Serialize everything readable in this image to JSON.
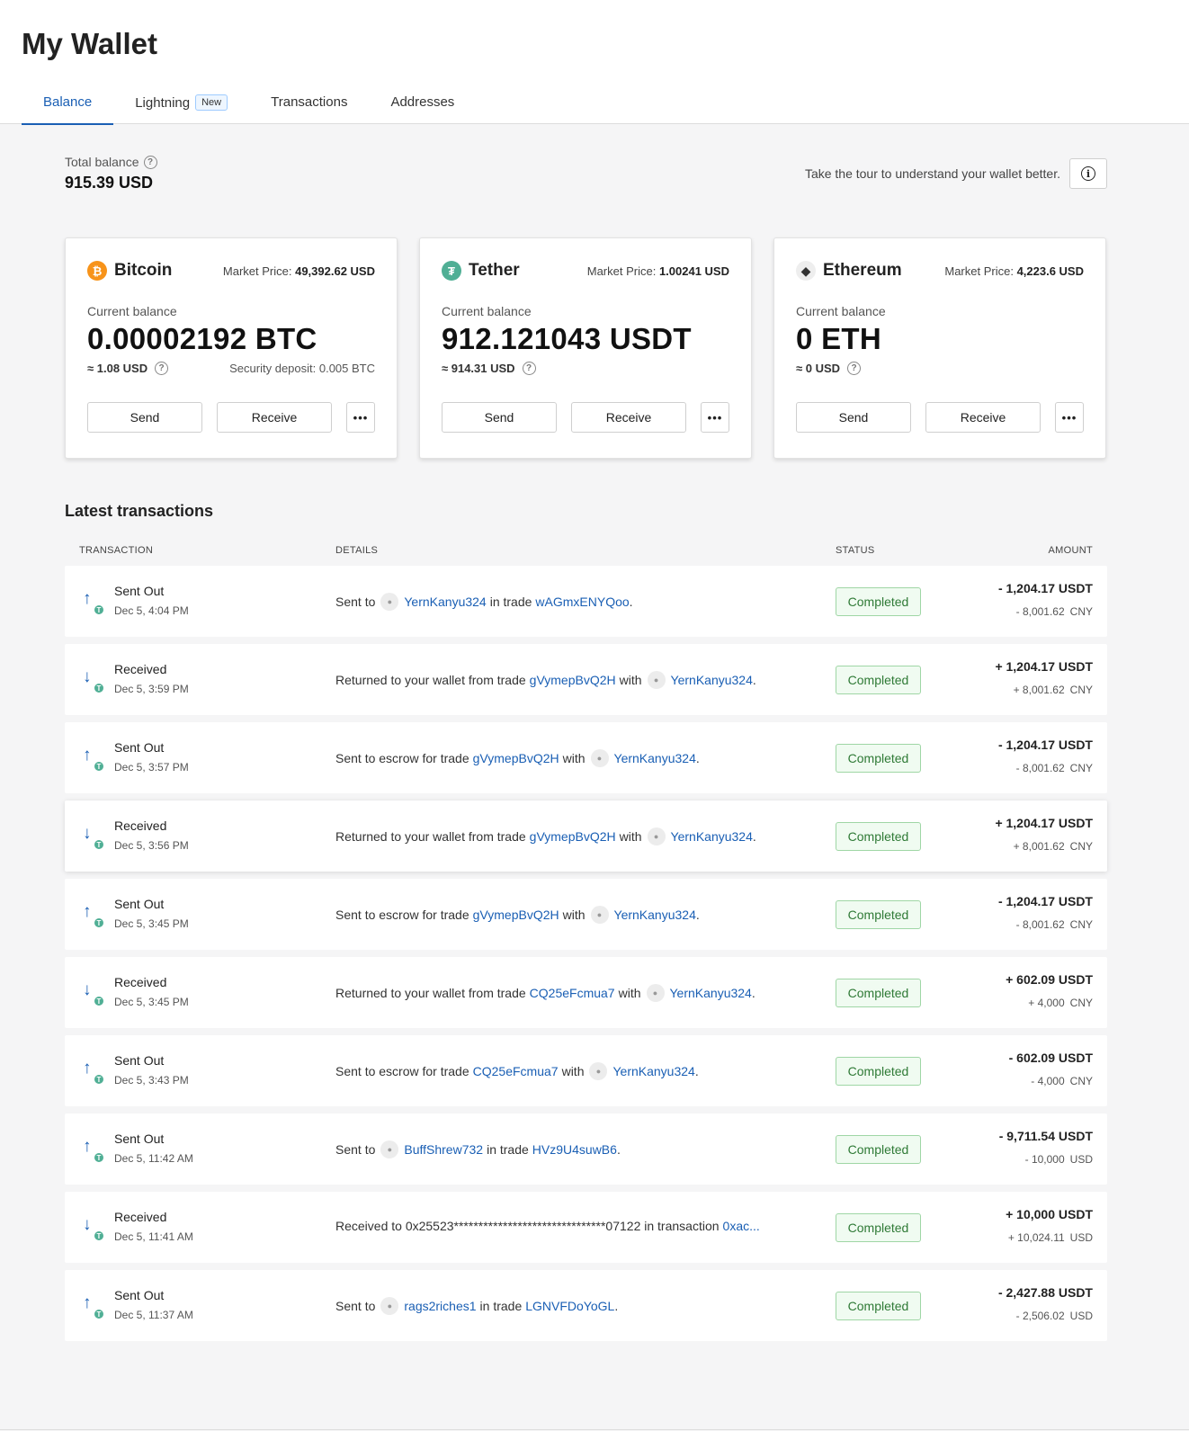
{
  "header": {
    "title": "My Wallet",
    "tabs": [
      {
        "label": "Balance",
        "active": true
      },
      {
        "label": "Lightning",
        "badge": "New"
      },
      {
        "label": "Transactions"
      },
      {
        "label": "Addresses"
      }
    ]
  },
  "summary": {
    "total_label": "Total balance",
    "total_value": "915.39 USD",
    "tour_text": "Take the tour to understand your wallet better."
  },
  "cards": [
    {
      "name": "Bitcoin",
      "icon": "bitcoin-icon",
      "market_label": "Market Price:",
      "market_price": "49,392.62 USD",
      "balance_label": "Current balance",
      "balance": "0.00002192 BTC",
      "approx": "≈ 1.08 USD",
      "deposit": "Security deposit: 0.005 BTC",
      "send": "Send",
      "receive": "Receive",
      "more": "•••"
    },
    {
      "name": "Tether",
      "icon": "tether-icon",
      "market_label": "Market Price:",
      "market_price": "1.00241 USD",
      "balance_label": "Current balance",
      "balance": "912.121043 USDT",
      "approx": "≈ 914.31 USD",
      "deposit": "",
      "send": "Send",
      "receive": "Receive",
      "more": "•••"
    },
    {
      "name": "Ethereum",
      "icon": "ethereum-icon",
      "market_label": "Market Price:",
      "market_price": "4,223.6 USD",
      "balance_label": "Current balance",
      "balance": "0 ETH",
      "approx": "≈ 0 USD",
      "deposit": "",
      "send": "Send",
      "receive": "Receive",
      "more": "•••"
    }
  ],
  "transactions": {
    "title": "Latest transactions",
    "columns": {
      "transaction": "TRANSACTION",
      "details": "DETAILS",
      "status": "STATUS",
      "amount": "AMOUNT"
    },
    "rows": [
      {
        "dir": "out",
        "type": "Sent Out",
        "date": "Dec 5, 4:04 PM",
        "details": [
          [
            "t",
            "Sent to"
          ],
          [
            "u",
            "YernKanyu324"
          ],
          [
            "t",
            "in trade"
          ],
          [
            "l",
            "wAGmxENYQoo"
          ],
          [
            "t",
            "."
          ]
        ],
        "status": "Completed",
        "amount": "- 1,204.17 USDT",
        "fiat": "- 8,001.62",
        "fiat_cur": "CNY"
      },
      {
        "dir": "in",
        "type": "Received",
        "date": "Dec 5, 3:59 PM",
        "details": [
          [
            "t",
            "Returned to your wallet from trade"
          ],
          [
            "l",
            "gVymepBvQ2H"
          ],
          [
            "t",
            "with"
          ],
          [
            "u",
            "YernKanyu324"
          ],
          [
            "t",
            "."
          ]
        ],
        "status": "Completed",
        "amount": "+ 1,204.17 USDT",
        "fiat": "+ 8,001.62",
        "fiat_cur": "CNY"
      },
      {
        "dir": "out",
        "type": "Sent Out",
        "date": "Dec 5, 3:57 PM",
        "details": [
          [
            "t",
            "Sent to escrow for trade"
          ],
          [
            "l",
            "gVymepBvQ2H"
          ],
          [
            "t",
            "with"
          ],
          [
            "u",
            "YernKanyu324"
          ],
          [
            "t",
            "."
          ]
        ],
        "status": "Completed",
        "amount": "- 1,204.17 USDT",
        "fiat": "- 8,001.62",
        "fiat_cur": "CNY"
      },
      {
        "dir": "in",
        "type": "Received",
        "date": "Dec 5, 3:56 PM",
        "details": [
          [
            "t",
            "Returned to your wallet from trade"
          ],
          [
            "l",
            "gVymepBvQ2H"
          ],
          [
            "t",
            "with"
          ],
          [
            "u",
            "YernKanyu324"
          ],
          [
            "t",
            "."
          ]
        ],
        "status": "Completed",
        "amount": "+ 1,204.17 USDT",
        "fiat": "+ 8,001.62",
        "fiat_cur": "CNY",
        "highlight": true
      },
      {
        "dir": "out",
        "type": "Sent Out",
        "date": "Dec 5, 3:45 PM",
        "details": [
          [
            "t",
            "Sent to escrow for trade"
          ],
          [
            "l",
            "gVymepBvQ2H"
          ],
          [
            "t",
            "with"
          ],
          [
            "u",
            "YernKanyu324"
          ],
          [
            "t",
            "."
          ]
        ],
        "status": "Completed",
        "amount": "- 1,204.17 USDT",
        "fiat": "- 8,001.62",
        "fiat_cur": "CNY"
      },
      {
        "dir": "in",
        "type": "Received",
        "date": "Dec 5, 3:45 PM",
        "details": [
          [
            "t",
            "Returned to your wallet from trade"
          ],
          [
            "l",
            "CQ25eFcmua7"
          ],
          [
            "t",
            "with"
          ],
          [
            "u",
            "YernKanyu324"
          ],
          [
            "t",
            "."
          ]
        ],
        "status": "Completed",
        "amount": "+ 602.09 USDT",
        "fiat": "+ 4,000",
        "fiat_cur": "CNY"
      },
      {
        "dir": "out",
        "type": "Sent Out",
        "date": "Dec 5, 3:43 PM",
        "details": [
          [
            "t",
            "Sent to escrow for trade"
          ],
          [
            "l",
            "CQ25eFcmua7"
          ],
          [
            "t",
            "with"
          ],
          [
            "u",
            "YernKanyu324"
          ],
          [
            "t",
            "."
          ]
        ],
        "status": "Completed",
        "amount": "- 602.09 USDT",
        "fiat": "- 4,000",
        "fiat_cur": "CNY"
      },
      {
        "dir": "out",
        "type": "Sent Out",
        "date": "Dec 5, 11:42 AM",
        "details": [
          [
            "t",
            "Sent to"
          ],
          [
            "u",
            "BuffShrew732"
          ],
          [
            "t",
            "in trade"
          ],
          [
            "l",
            "HVz9U4suwB6"
          ],
          [
            "t",
            "."
          ]
        ],
        "status": "Completed",
        "amount": "- 9,711.54 USDT",
        "fiat": "- 10,000",
        "fiat_cur": "USD"
      },
      {
        "dir": "in",
        "type": "Received",
        "date": "Dec 5, 11:41 AM",
        "details": [
          [
            "t",
            "Received to 0x25523*******************************07122 in transaction"
          ],
          [
            "l",
            "0xac..."
          ]
        ],
        "status": "Completed",
        "amount": "+ 10,000 USDT",
        "fiat": "+ 10,024.11",
        "fiat_cur": "USD"
      },
      {
        "dir": "out",
        "type": "Sent Out",
        "date": "Dec 5, 11:37 AM",
        "details": [
          [
            "t",
            "Sent to"
          ],
          [
            "u",
            "rags2riches1"
          ],
          [
            "t",
            "in trade"
          ],
          [
            "l",
            "LGNVFDoYoGL"
          ],
          [
            "t",
            "."
          ]
        ],
        "status": "Completed",
        "amount": "- 2,427.88 USDT",
        "fiat": "- 2,506.02",
        "fiat_cur": "USD"
      }
    ]
  }
}
